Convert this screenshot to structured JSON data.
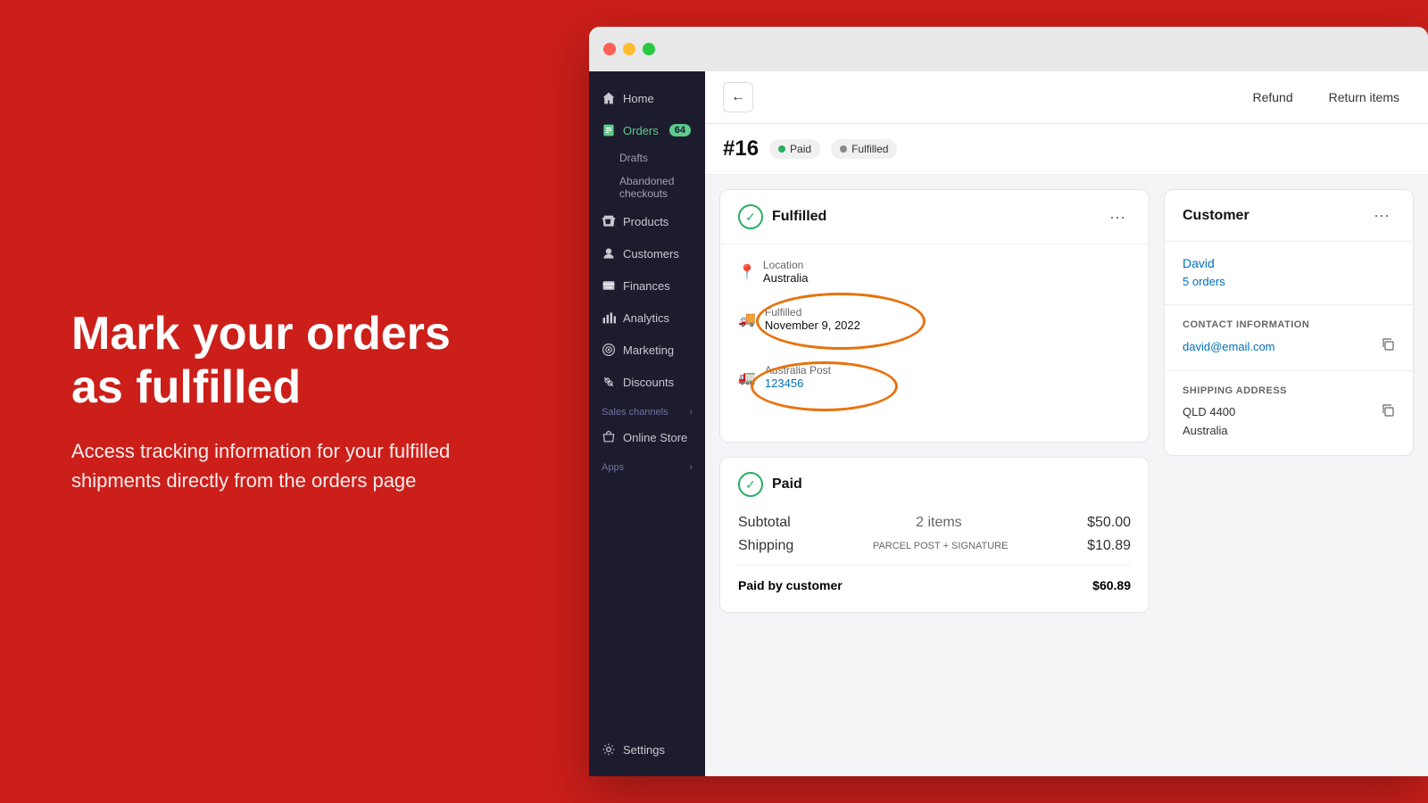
{
  "hero": {
    "title": "Mark your orders as fulfilled",
    "subtitle": "Access tracking information for your fulfilled shipments directly from the orders page"
  },
  "browser": {
    "dots": [
      "red",
      "yellow",
      "green"
    ]
  },
  "sidebar": {
    "items": [
      {
        "id": "home",
        "label": "Home",
        "icon": "🏠",
        "active": false
      },
      {
        "id": "orders",
        "label": "Orders",
        "icon": "📋",
        "active": true,
        "badge": "64"
      },
      {
        "id": "drafts",
        "label": "Drafts",
        "sub": true
      },
      {
        "id": "abandoned",
        "label": "Abandoned checkouts",
        "sub": true
      },
      {
        "id": "products",
        "label": "Products",
        "icon": "🏷️",
        "active": false
      },
      {
        "id": "customers",
        "label": "Customers",
        "icon": "👤",
        "active": false
      },
      {
        "id": "finances",
        "label": "Finances",
        "icon": "🏦",
        "active": false
      },
      {
        "id": "analytics",
        "label": "Analytics",
        "icon": "📊",
        "active": false
      },
      {
        "id": "marketing",
        "label": "Marketing",
        "icon": "🎯",
        "active": false
      },
      {
        "id": "discounts",
        "label": "Discounts",
        "icon": "🏷️",
        "active": false
      }
    ],
    "sales_channels_label": "Sales channels",
    "online_store_label": "Online Store",
    "apps_label": "Apps",
    "settings_label": "Settings"
  },
  "topbar": {
    "refund_label": "Refund",
    "return_items_label": "Return items"
  },
  "order": {
    "number": "#16",
    "paid_badge": "Paid",
    "fulfilled_badge": "Fulfilled"
  },
  "fulfilled_card": {
    "title": "Fulfilled",
    "location_label": "Location",
    "location_value": "Australia",
    "fulfilled_label": "Fulfilled",
    "fulfilled_date": "November 9, 2022",
    "carrier": "Australia Post",
    "tracking_number": "123456"
  },
  "paid_card": {
    "title": "Paid",
    "subtotal_label": "Subtotal",
    "subtotal_items": "2 items",
    "subtotal_amount": "$50.00",
    "shipping_label": "Shipping",
    "shipping_method": "PARCEL POST + SIGNATURE",
    "shipping_amount": "$10.89",
    "paid_by_label": "Paid by customer",
    "total_amount": "$60.89"
  },
  "customer_card": {
    "title": "Customer",
    "name": "David",
    "orders_text": "5 orders",
    "contact_section_label": "CONTACT INFORMATION",
    "email": "david@email.com",
    "shipping_section_label": "SHIPPING ADDRESS",
    "address_line1": "QLD 4400",
    "address_line2": "Australia"
  },
  "colors": {
    "red_bg": "#cc1f1a",
    "green": "#27ae60",
    "orange_circle": "#e8720c",
    "link_blue": "#006fbb"
  }
}
